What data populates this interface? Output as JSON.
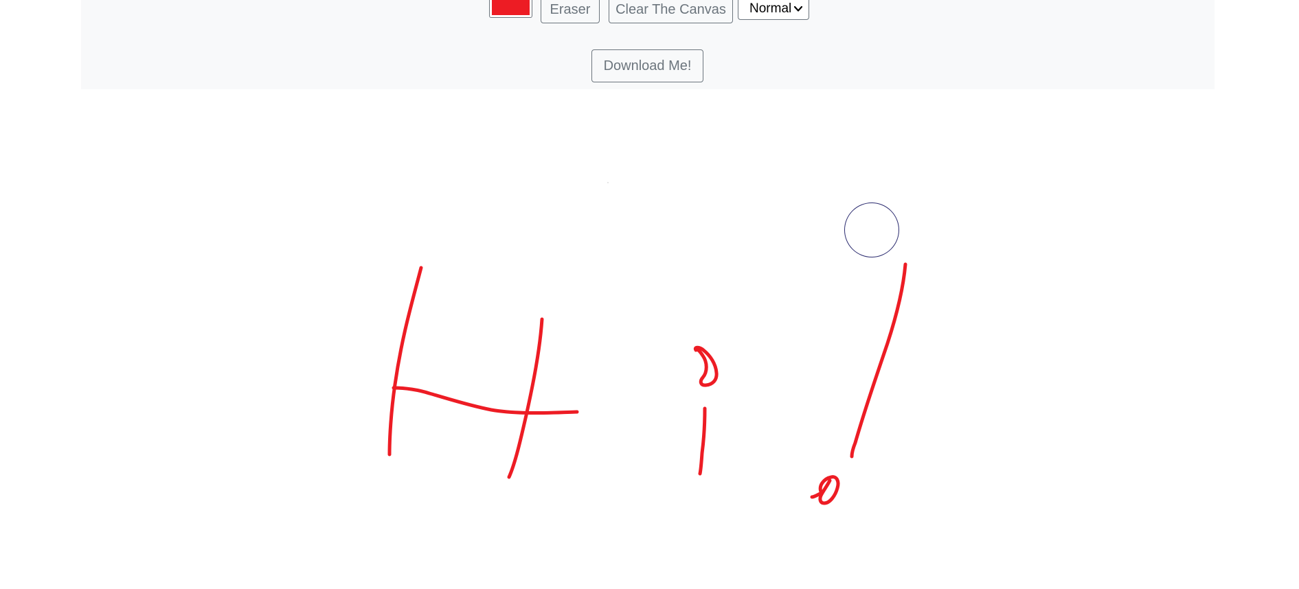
{
  "toolbar": {
    "selected_color": "#ed1c24",
    "eraser_label": "Eraser",
    "clear_label": "Clear The Canvas",
    "mode_select": {
      "selected": "Normal"
    },
    "download_label": "Download Me!"
  },
  "canvas": {
    "stroke_color": "#ed1c24",
    "background": "#ffffff"
  },
  "icons": {
    "chevron": "chevron-down-icon"
  }
}
